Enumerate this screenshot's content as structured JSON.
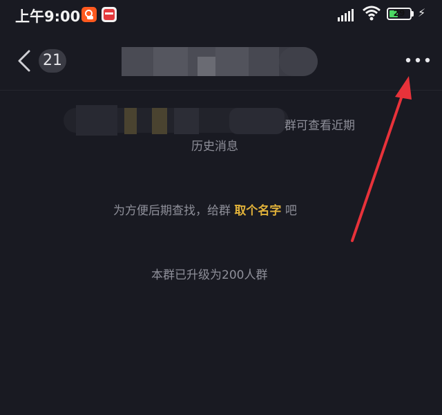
{
  "status_bar": {
    "time": "上午9:00",
    "battery_level": "29",
    "icons": [
      "kuaishou-app-icon",
      "red-app-icon",
      "signal-icon",
      "wifi-icon",
      "battery-icon",
      "charging-icon"
    ]
  },
  "nav": {
    "unread_count": "21",
    "title": "",
    "back_icon": "chevron-left-icon",
    "more_icon": "more-dots-icon"
  },
  "messages": {
    "history_tip_line1": "群可查看近期",
    "history_tip_line2": "历史消息",
    "name_tip_prefix": "为方便后期查找，给群",
    "name_tip_link": "取个名字",
    "name_tip_suffix": "吧",
    "upgrade_tip": "本群已升级为200人群"
  },
  "colors": {
    "background": "#191a22",
    "link": "#e0b13a",
    "tip_text": "#8e8f99",
    "annotation_arrow": "#e8323a"
  }
}
